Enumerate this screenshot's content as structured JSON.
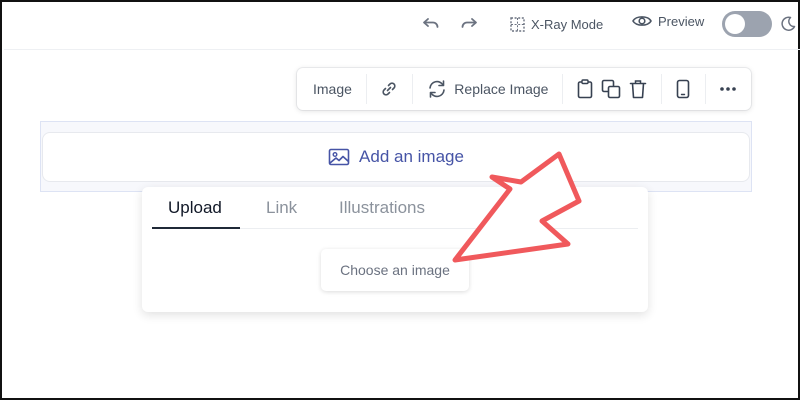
{
  "topbar": {
    "undo_icon": "undo-icon",
    "redo_icon": "redo-icon",
    "xray_label": "X-Ray Mode",
    "preview_label": "Preview",
    "preview_toggle_on": false,
    "dark_mode_icon": "moon-icon"
  },
  "toolbar": {
    "image_label": "Image",
    "replace_label": "Replace Image",
    "icons": [
      "link-icon",
      "refresh-icon",
      "clipboard-icon",
      "duplicate-icon",
      "trash-icon",
      "mobile-icon",
      "more-icon"
    ]
  },
  "image_block": {
    "add_label": "Add an image"
  },
  "popover": {
    "tabs": [
      {
        "label": "Upload",
        "active": true
      },
      {
        "label": "Link",
        "active": false
      },
      {
        "label": "Illustrations",
        "active": false
      }
    ],
    "choose_label": "Choose an image"
  },
  "colors": {
    "accent": "#4654a6",
    "annotation_arrow": "#f0595c",
    "toggle_off": "#9ca3af"
  }
}
